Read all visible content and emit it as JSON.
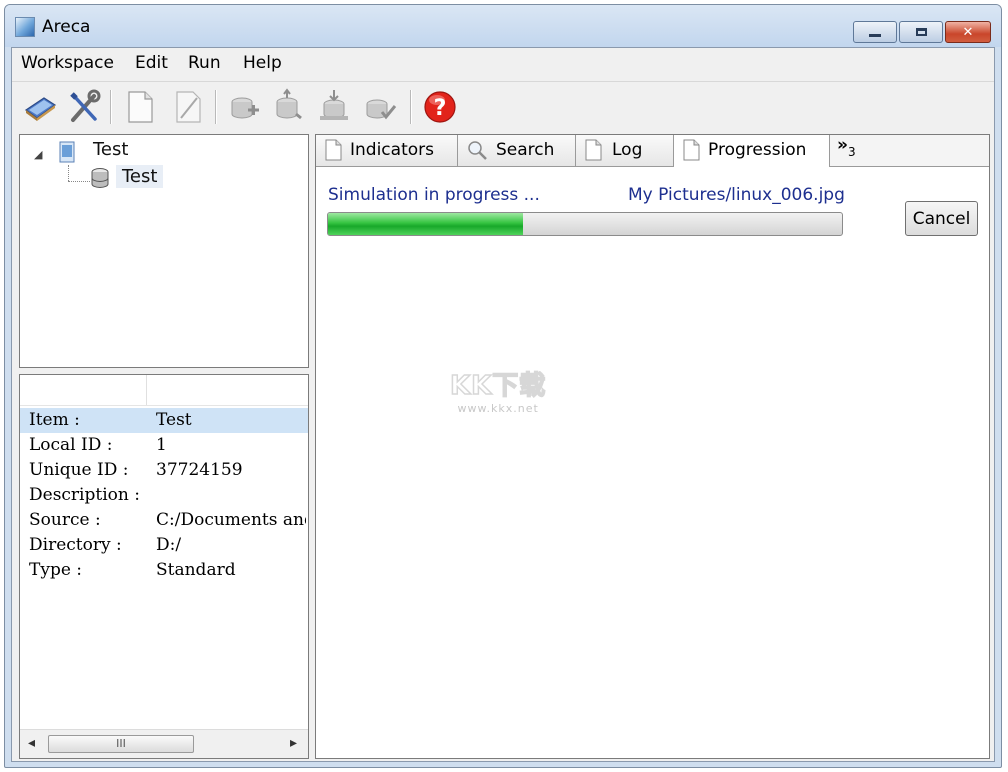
{
  "window": {
    "title": "Areca"
  },
  "menu": [
    "Workspace",
    "Edit",
    "Run",
    "Help"
  ],
  "toolbar": {
    "icons": [
      "workspace-icon",
      "tools-icon",
      "new-document-icon",
      "edit-icon",
      "backup-icon",
      "merge-icon",
      "recover-icon",
      "check-icon",
      "help-icon"
    ]
  },
  "tree": {
    "root_label": "Test",
    "child_label": "Test"
  },
  "properties": {
    "rows": [
      {
        "key": "Item :",
        "value": "Test"
      },
      {
        "key": "Local ID :",
        "value": "1"
      },
      {
        "key": "Unique ID :",
        "value": "37724159"
      },
      {
        "key": "Description :",
        "value": ""
      },
      {
        "key": "Source :",
        "value": "C:/Documents and"
      },
      {
        "key": "Directory :",
        "value": "D:/"
      },
      {
        "key": "Type :",
        "value": "Standard"
      }
    ],
    "scroll_thumb": "III"
  },
  "tabs": [
    {
      "label": "Indicators",
      "icon": "document-icon"
    },
    {
      "label": "Search",
      "icon": "magnifier-icon"
    },
    {
      "label": "Log",
      "icon": "document-icon"
    },
    {
      "label": "Progression",
      "icon": "document-icon"
    }
  ],
  "tabs_overflow": {
    "glyph": "»",
    "count": "3"
  },
  "progression": {
    "status": "Simulation in progress ...",
    "current_file": "My Pictures/linux_006.jpg",
    "progress_fraction": 0.38,
    "cancel_label": "Cancel"
  },
  "watermark": {
    "logo": "KK下载",
    "url": "www.kkx.net"
  },
  "colors": {
    "status_text": "#1d2f8f",
    "progress_green": "#2fbf3c",
    "selection": "#cfe3f6"
  }
}
